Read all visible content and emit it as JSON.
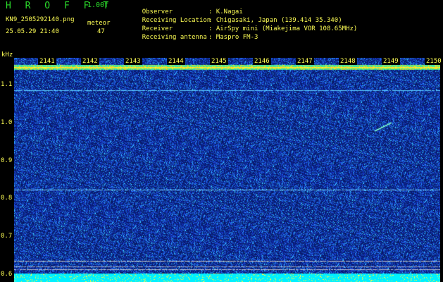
{
  "header": {
    "title": "H R O F F T",
    "version": "1.00f",
    "filename": "KN9_2505292140.png",
    "datetime": "25.05.29 21:40",
    "meteor_label": "meteor",
    "meteor_count": "47"
  },
  "meta": [
    {
      "label": "Observer",
      "value": ": K.Nagai"
    },
    {
      "label": "Receiving Location",
      "value": ": Chigasaki, Japan (139.414 35.340)"
    },
    {
      "label": "Receiver",
      "value": ": AirSpy mini (Miakejima VOR 108.65MHz)"
    },
    {
      "label": "Receiving antenna",
      "value": ": Maspro FM-3"
    }
  ],
  "chart_data": {
    "type": "heatmap",
    "ylabel": "kHz",
    "y_ticks": [
      "1.1",
      "1.0",
      "0.9",
      "0.8",
      "0.7",
      "0.6"
    ],
    "x_ticks": [
      "2141",
      "2142",
      "2143",
      "2144",
      "2145",
      "2146",
      "2147",
      "2148",
      "2149",
      "2150"
    ],
    "ylim": [
      0.58,
      1.17
    ],
    "colors": {
      "background": "#000000",
      "low": "#0a1470",
      "mid": "#2c50ff",
      "high": "#00ffff",
      "peak": "#ffff00"
    }
  }
}
